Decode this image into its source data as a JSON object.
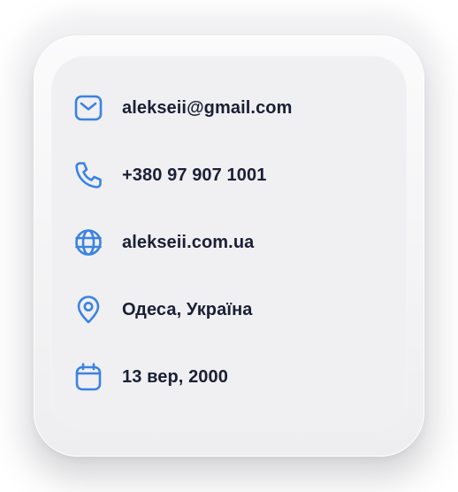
{
  "accent_color": "#3b82e6",
  "contacts": [
    {
      "icon": "mail-icon",
      "value": "alekseii@gmail.com"
    },
    {
      "icon": "phone-icon",
      "value": "+380 97 907 1001"
    },
    {
      "icon": "globe-icon",
      "value": "alekseii.com.ua"
    },
    {
      "icon": "location-pin-icon",
      "value": "Одеса, Україна"
    },
    {
      "icon": "calendar-icon",
      "value": "13 вер, 2000"
    }
  ]
}
